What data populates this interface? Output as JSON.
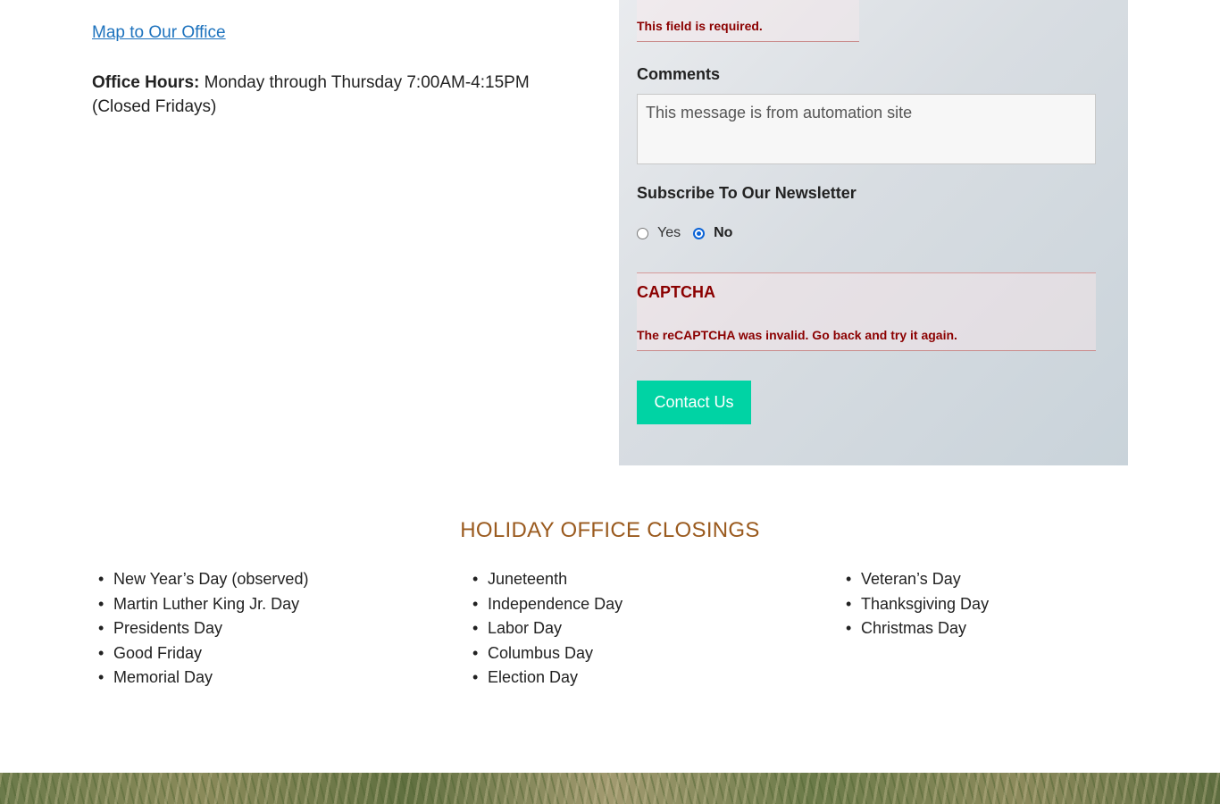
{
  "contact_info": {
    "map_link": "Map to Our Office",
    "hours_label": "Office Hours:",
    "hours_text": "Monday through Thursday 7:00AM-4:15PM (Closed Fridays)"
  },
  "form": {
    "field_error": "This field is required.",
    "comments_label": "Comments",
    "comments_value": "This message is from automation site",
    "newsletter_label": "Subscribe To Our Newsletter",
    "newsletter_options": [
      {
        "label": "Yes",
        "checked": false
      },
      {
        "label": "No",
        "checked": true
      }
    ],
    "captcha_title": "CAPTCHA",
    "captcha_error": "The reCAPTCHA was invalid. Go back and try it again.",
    "submit_label": "Contact Us",
    "colors": {
      "error": "#8b0000",
      "submit_bg": "#00d3a4",
      "radio_accent": "#0b63d6"
    }
  },
  "holidays": {
    "heading": "HOLIDAY OFFICE CLOSINGS",
    "heading_color": "#9a5a1e",
    "columns": [
      [
        "New Year’s Day (observed)",
        "Martin Luther King Jr. Day",
        "Presidents Day",
        "Good Friday",
        "Memorial Day"
      ],
      [
        "Juneteenth",
        "Independence Day",
        "Labor Day",
        "Columbus Day",
        "Election Day"
      ],
      [
        "Veteran’s Day",
        "Thanksgiving Day",
        "Christmas Day"
      ]
    ]
  }
}
